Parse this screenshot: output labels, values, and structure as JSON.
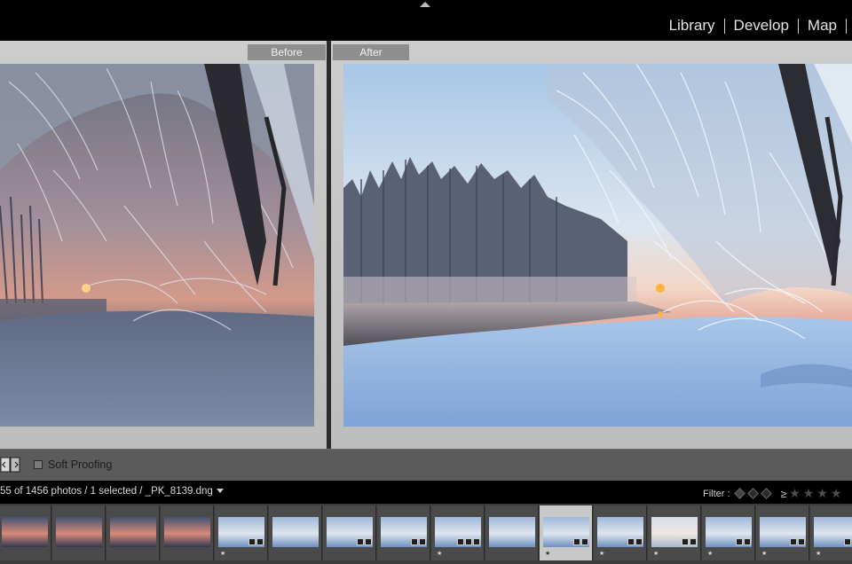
{
  "modules": [
    "Library",
    "Develop",
    "Map"
  ],
  "compare": {
    "before_label": "Before",
    "after_label": "After"
  },
  "toolbar": {
    "soft_proofing_label": "Soft Proofing",
    "soft_proofing_checked": false
  },
  "filmstrip_header": {
    "photo_count_text": "55 of 1456 photos / 1 selected / _PK_8139.dng",
    "filter_label": "Filter :",
    "rating_operator": "≥",
    "rating_stars_count": 4
  },
  "filmstrip": {
    "thumbnails": [
      {
        "tone": "warm",
        "starred": false,
        "badges": 0,
        "selected": false
      },
      {
        "tone": "warm",
        "starred": false,
        "badges": 0,
        "selected": false
      },
      {
        "tone": "warm",
        "starred": false,
        "badges": 0,
        "selected": false
      },
      {
        "tone": "warm",
        "starred": false,
        "badges": 0,
        "selected": false
      },
      {
        "tone": "cool",
        "starred": true,
        "badges": 2,
        "selected": false
      },
      {
        "tone": "cool",
        "starred": false,
        "badges": 0,
        "selected": false
      },
      {
        "tone": "cool",
        "starred": false,
        "badges": 2,
        "selected": false
      },
      {
        "tone": "cool",
        "starred": false,
        "badges": 2,
        "selected": false
      },
      {
        "tone": "cool",
        "starred": true,
        "badges": 3,
        "selected": false
      },
      {
        "tone": "cool",
        "starred": false,
        "badges": 0,
        "selected": false
      },
      {
        "tone": "cool",
        "starred": true,
        "badges": 2,
        "selected": true
      },
      {
        "tone": "cool",
        "starred": true,
        "badges": 2,
        "selected": false
      },
      {
        "tone": "pale",
        "starred": true,
        "badges": 2,
        "selected": false
      },
      {
        "tone": "cool",
        "starred": true,
        "badges": 2,
        "selected": false
      },
      {
        "tone": "cool",
        "starred": true,
        "badges": 2,
        "selected": false
      },
      {
        "tone": "cool",
        "starred": true,
        "badges": 2,
        "selected": false
      }
    ]
  },
  "colors": {
    "panel_gray": "#c9c9c9",
    "toolbar_gray": "#5b5b5b",
    "selected_cell": "#c8c8c8"
  }
}
